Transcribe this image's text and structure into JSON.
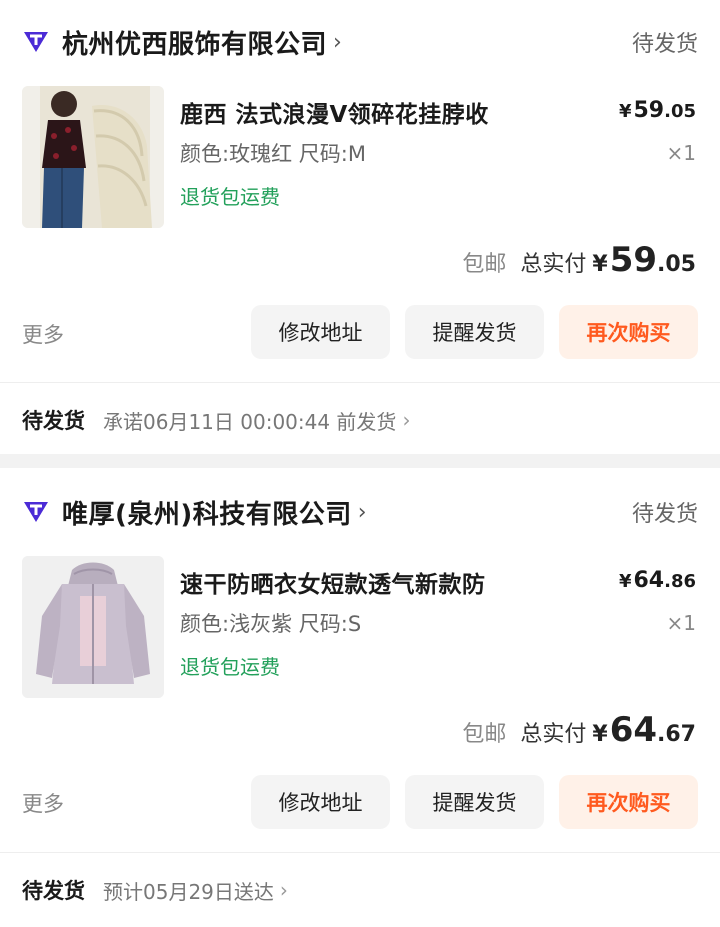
{
  "orders": [
    {
      "store": {
        "name": "杭州优西服饰有限公司",
        "status": "待发货"
      },
      "item": {
        "title": "鹿西 法式浪漫V领碎花挂脖收",
        "spec": "颜色:玫瑰红 尺码:M",
        "return_tag": "退货包运费",
        "price_yen": "¥",
        "price_int": "59",
        "price_dec": ".05",
        "qty": "×1"
      },
      "total": {
        "free_ship": "包邮",
        "label": "总实付",
        "yen": "¥",
        "int": "59",
        "dec": ".05"
      },
      "actions": {
        "more": "更多",
        "change_address": "修改地址",
        "remind": "提醒发货",
        "rebuy": "再次购买"
      },
      "shipping": {
        "label": "待发货",
        "text": "承诺06月11日 00:00:44 前发货"
      }
    },
    {
      "store": {
        "name": "唯厚(泉州)科技有限公司",
        "status": "待发货"
      },
      "item": {
        "title": "速干防晒衣女短款透气新款防",
        "spec": "颜色:浅灰紫 尺码:S",
        "return_tag": "退货包运费",
        "price_yen": "¥",
        "price_int": "64",
        "price_dec": ".86",
        "qty": "×1"
      },
      "total": {
        "free_ship": "包邮",
        "label": "总实付",
        "yen": "¥",
        "int": "64",
        "dec": ".67"
      },
      "actions": {
        "more": "更多",
        "change_address": "修改地址",
        "remind": "提醒发货",
        "rebuy": "再次购买"
      },
      "shipping": {
        "label": "待发货",
        "text": "预计05月29日送达"
      }
    }
  ],
  "colors": {
    "accent": "#ff5a1f",
    "green": "#22a05a",
    "brand_logo": "#4b2bd6"
  }
}
